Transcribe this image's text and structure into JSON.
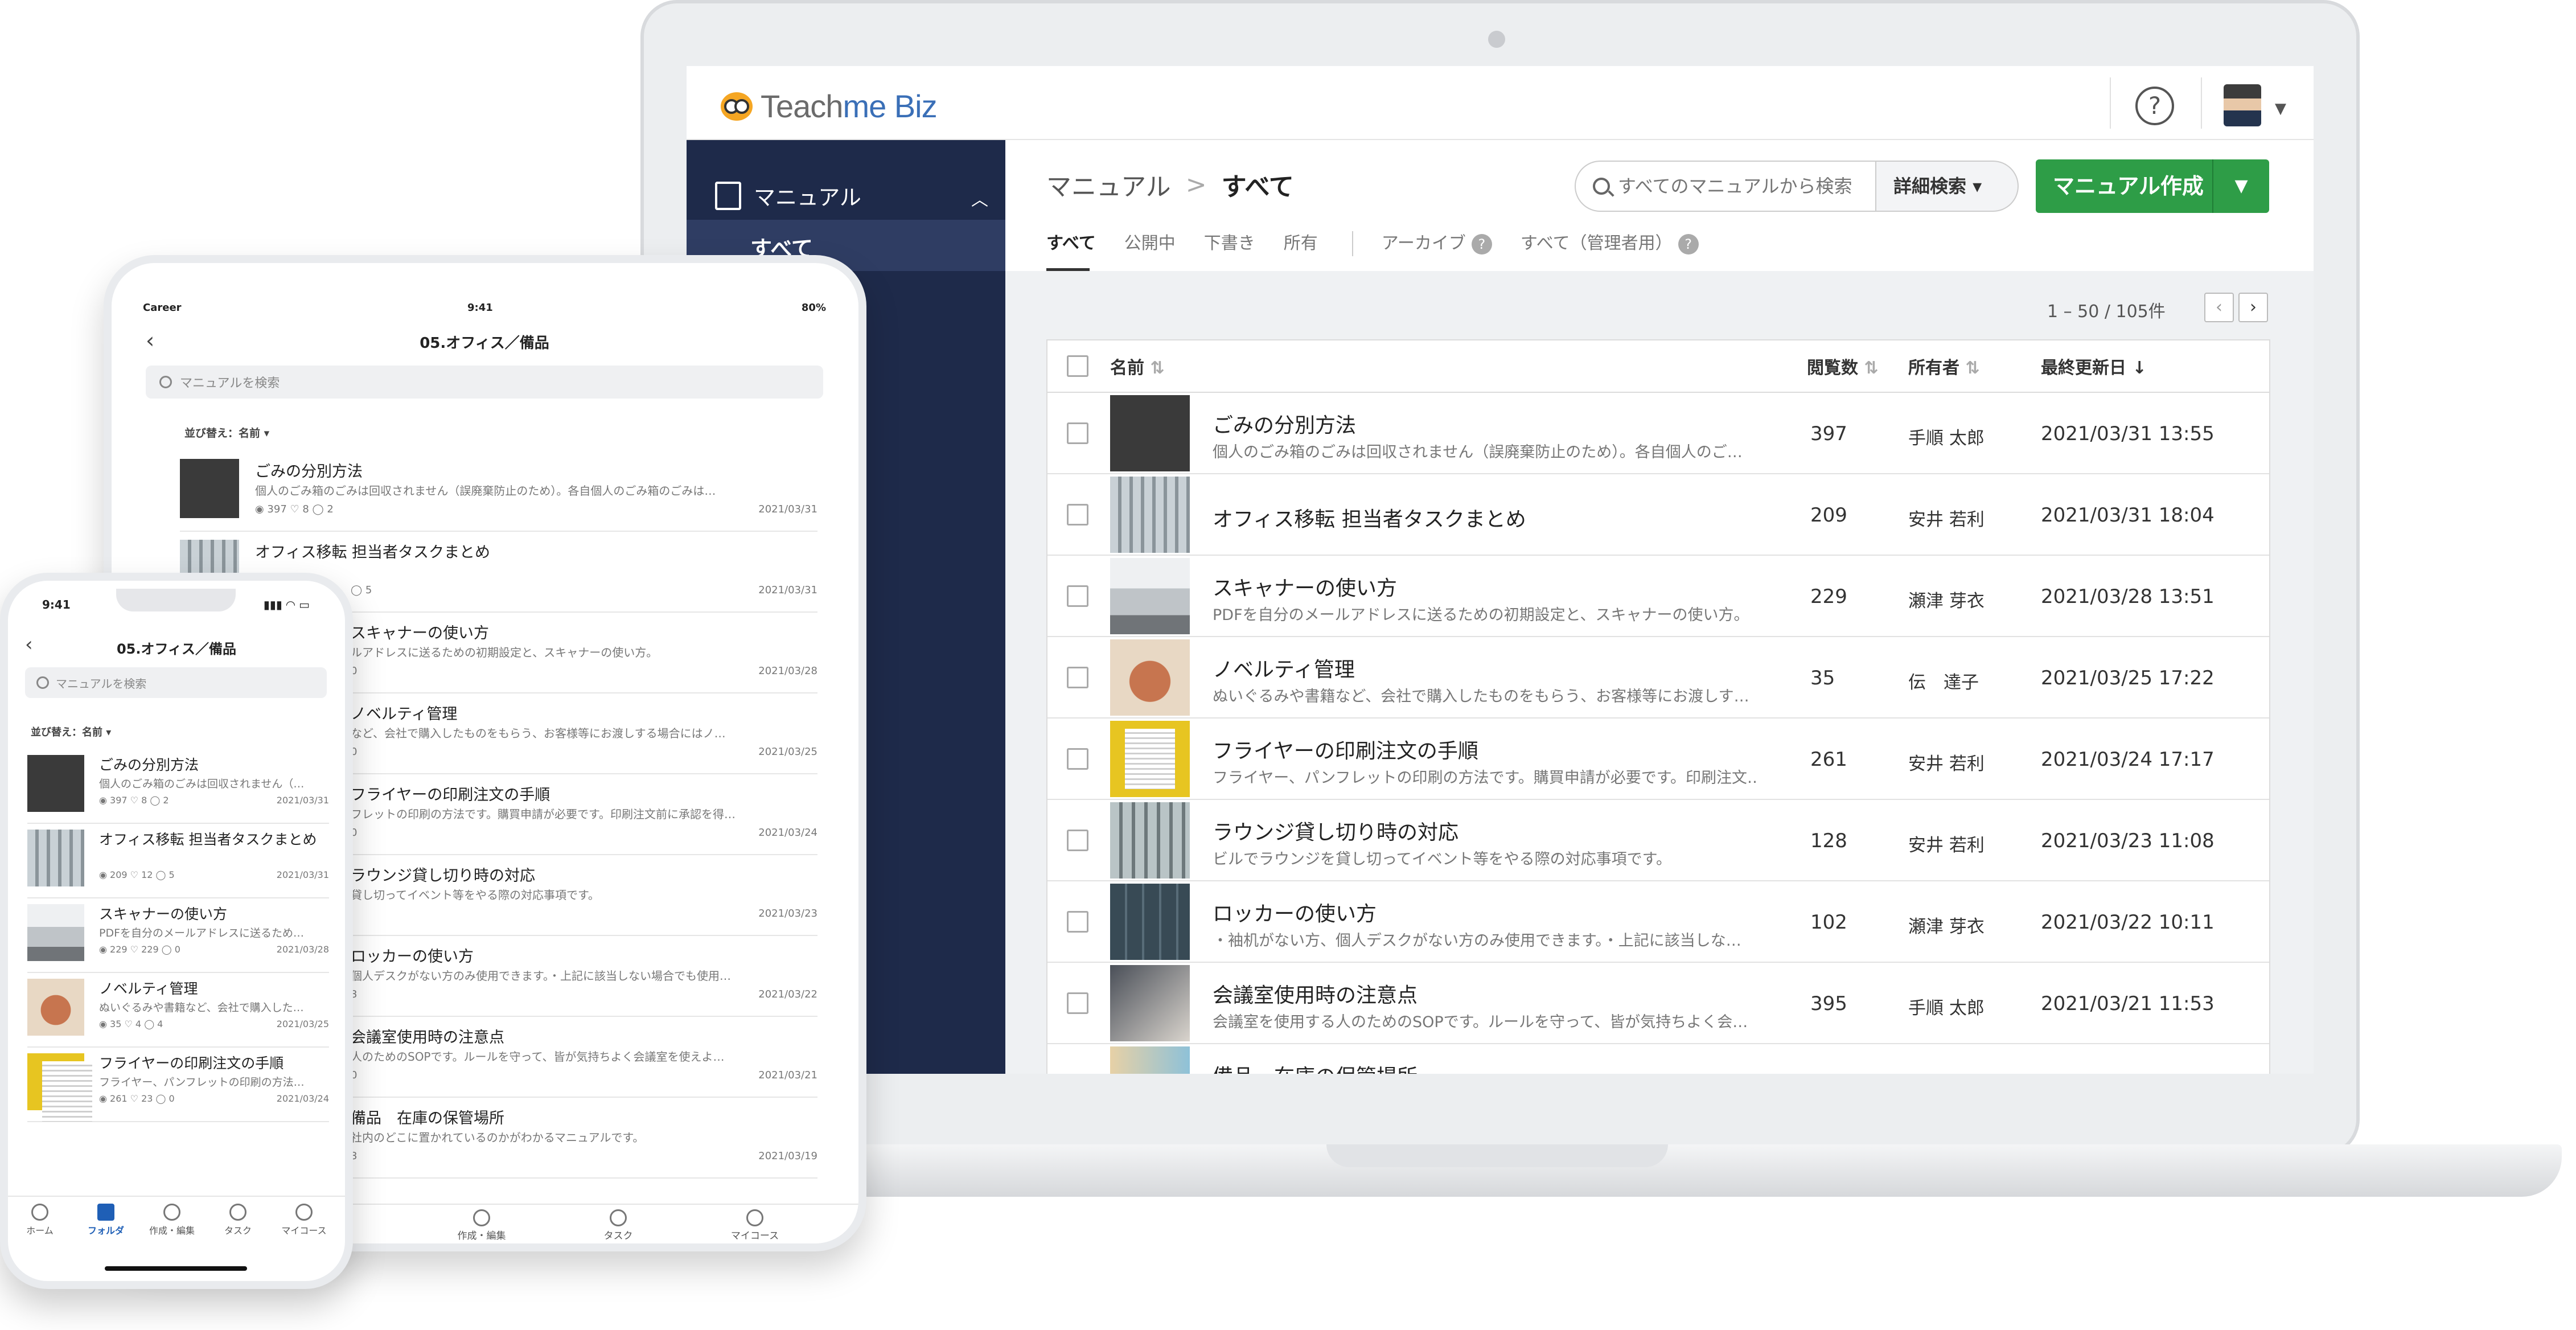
{
  "brand": {
    "logo_text_a": "Teach",
    "logo_text_b": "me Biz"
  },
  "header": {
    "help": "?"
  },
  "sidebar": {
    "section_label": "マニュアル",
    "active_item": "すべて"
  },
  "breadcrumb": {
    "root": "マニュアル",
    "separator": ">",
    "current": "すべて"
  },
  "search": {
    "placeholder": "すべてのマニュアルから検索",
    "advanced_label": "詳細検索"
  },
  "create_button": {
    "label": "マニュアル作成"
  },
  "tabs": {
    "all": "すべて",
    "published": "公開中",
    "draft": "下書き",
    "owned": "所有",
    "archive": "アーカイブ",
    "all_admin": "すべて（管理者用）"
  },
  "pagination": {
    "range": "1 – 50 / 105件"
  },
  "table": {
    "headers": {
      "name": "名前",
      "views": "閲覧数",
      "owner": "所有者",
      "updated": "最終更新日"
    },
    "rows": [
      {
        "title": "ごみの分別方法",
        "desc": "個人のごみ箱のごみは回収されません（誤廃棄防止のため）。各自個人のご…",
        "views": "397",
        "owner": "手順 太郎",
        "date": "2021/03/31 13:55",
        "thumb": "trash-thumbnail"
      },
      {
        "title": "オフィス移転 担当者タスクまとめ",
        "desc": "",
        "views": "209",
        "owner": "安井 若利",
        "date": "2021/03/31 18:04",
        "thumb": "office-thumbnail"
      },
      {
        "title": "スキャナーの使い方",
        "desc": "PDFを自分のメールアドレスに送るための初期設定と、スキャナーの使い方。",
        "views": "229",
        "owner": "瀬津 芽衣",
        "date": "2021/03/28 13:51",
        "thumb": "scanner-thumbnail"
      },
      {
        "title": "ノベルティ管理",
        "desc": "ぬいぐるみや書籍など、会社で購入したものをもらう、お客様等にお渡しす…",
        "views": "35",
        "owner": "伝　達子",
        "date": "2021/03/25 17:22",
        "thumb": "bear-thumbnail"
      },
      {
        "title": "フライヤーの印刷注文の手順",
        "desc": "フライヤー、パンフレットの印刷の方法です。購買申請が必要です。印刷注文…",
        "views": "261",
        "owner": "安井 若利",
        "date": "2021/03/24 17:17",
        "thumb": "flyer-thumbnail"
      },
      {
        "title": "ラウンジ貸し切り時の対応",
        "desc": "ビルでラウンジを貸し切ってイベント等をやる際の対応事項です。",
        "views": "128",
        "owner": "安井 若利",
        "date": "2021/03/23 11:08",
        "thumb": "lounge-thumbnail"
      },
      {
        "title": "ロッカーの使い方",
        "desc": "・袖机がない方、個人デスクがない方のみ使用できます。・上記に該当しな…",
        "views": "102",
        "owner": "瀬津 芽衣",
        "date": "2021/03/22 10:11",
        "thumb": "locker-thumbnail"
      },
      {
        "title": "会議室使用時の注意点",
        "desc": "会議室を使用する人のためのSOPです。ルールを守って、皆が気持ちよく会…",
        "views": "395",
        "owner": "手順 太郎",
        "date": "2021/03/21 11:53",
        "thumb": "meeting-thumbnail"
      },
      {
        "title": "備品　在庫の保管場所",
        "desc": "",
        "views": "",
        "owner": "",
        "date": "",
        "thumb": "people-thumbnail"
      }
    ]
  },
  "tablet": {
    "carrier": "Career",
    "time": "9:41",
    "battery": "80%",
    "title": "05.オフィス／備品",
    "search_placeholder": "マニュアルを検索",
    "sort": "並び替え：名前 ▾",
    "items": [
      {
        "title": "ごみの分別方法",
        "desc": "個人のごみ箱のごみは回収されません（誤廃棄防止のため）。各自個人のごみ箱のごみは…",
        "meta": "◉ 397  ♡ 8  ◯ 2",
        "date": "2021/03/31"
      },
      {
        "title": "オフィス移転 担当者タスクまとめ",
        "desc": "",
        "meta": "◯ 5",
        "date": "2021/03/31"
      },
      {
        "title": "スキャナーの使い方",
        "desc": "ルアドレスに送るための初期設定と、スキャナーの使い方。",
        "meta": "0",
        "date": "2021/03/28"
      },
      {
        "title": "ノベルティ管理",
        "desc": "など、会社で購入したものをもらう、お客様等にお渡しする場合にはノ…",
        "meta": "0",
        "date": "2021/03/25"
      },
      {
        "title": "フライヤーの印刷注文の手順",
        "desc": "フレットの印刷の方法です。購買申請が必要です。印刷注文前に承認を得…",
        "meta": "0",
        "date": "2021/03/24"
      },
      {
        "title": "ラウンジ貸し切り時の対応",
        "desc": "貸し切ってイベント等をやる際の対応事項です。",
        "meta": "",
        "date": "2021/03/23"
      },
      {
        "title": "ロッカーの使い方",
        "desc": "個人デスクがない方のみ使用できます。・上記に該当しない場合でも使用…",
        "meta": "3",
        "date": "2021/03/22"
      },
      {
        "title": "会議室使用時の注意点",
        "desc": "人のためのSOPです。ルールを守って、皆が気持ちよく会議室を使えよ…",
        "meta": "0",
        "date": "2021/03/21"
      },
      {
        "title": "備品　在庫の保管場所",
        "desc": "社内のどこに置かれているのかがわかるマニュアルです。",
        "meta": "3",
        "date": "2021/03/19"
      }
    ],
    "tabbar": {
      "create": "作成・編集",
      "task": "タスク",
      "mycourse": "マイコース"
    }
  },
  "phone": {
    "time": "9:41",
    "title": "05.オフィス／備品",
    "search_placeholder": "マニュアルを検索",
    "sort": "並び替え：名前 ▾",
    "items": [
      {
        "title": "ごみの分別方法",
        "desc": "個人のごみ箱のごみは回収されません（…",
        "meta": "◉ 397  ♡ 8  ◯ 2",
        "date": "2021/03/31"
      },
      {
        "title": "オフィス移転 担当者タスクまとめ",
        "desc": "",
        "meta": "◉ 209  ♡ 12  ◯ 5",
        "date": "2021/03/31"
      },
      {
        "title": "スキャナーの使い方",
        "desc": "PDFを自分のメールアドレスに送るため…",
        "meta": "◉ 229  ♡ 229  ◯ 0",
        "date": "2021/03/28"
      },
      {
        "title": "ノベルティ管理",
        "desc": "ぬいぐるみや書籍など、会社で購入した…",
        "meta": "◉ 35  ♡ 4  ◯ 4",
        "date": "2021/03/25"
      },
      {
        "title": "フライヤーの印刷注文の手順",
        "desc": "フライヤー、パンフレットの印刷の方法…",
        "meta": "◉ 261  ♡ 23  ◯ 0",
        "date": "2021/03/24"
      }
    ],
    "tabbar": {
      "home": "ホーム",
      "folder": "フォルダ",
      "create": "作成・編集",
      "task": "タスク",
      "mycourse": "マイコース"
    }
  },
  "colors": {
    "sidebar": "#1e2a4a",
    "accent_green": "#2e9d47",
    "active_blue": "#1f5fb6"
  }
}
